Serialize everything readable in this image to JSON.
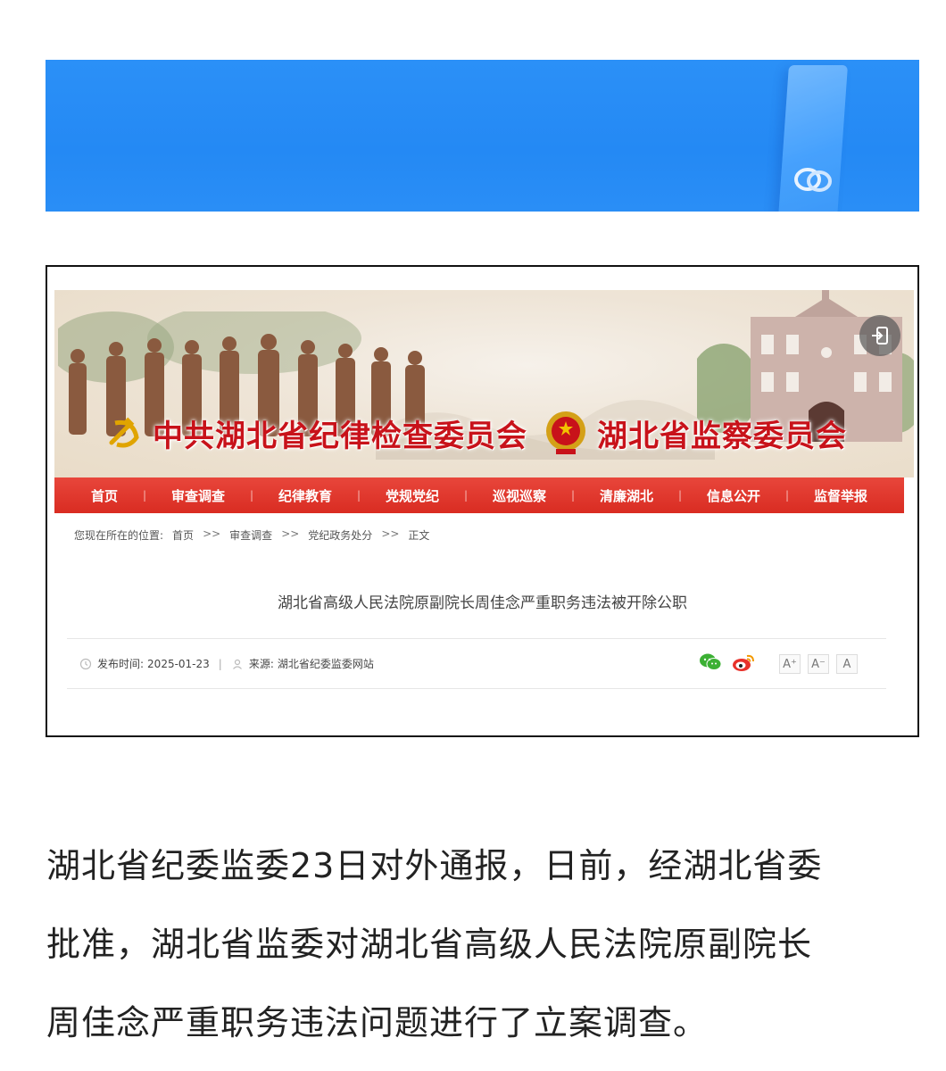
{
  "site": {
    "title_left": "中共湖北省纪律检查委员会",
    "title_right": "湖北省监察委员会"
  },
  "nav": [
    {
      "label": "首页"
    },
    {
      "label": "审查调查"
    },
    {
      "label": "纪律教育"
    },
    {
      "label": "党规党纪"
    },
    {
      "label": "巡视巡察"
    },
    {
      "label": "清廉湖北"
    },
    {
      "label": "信息公开"
    },
    {
      "label": "监督举报"
    }
  ],
  "breadcrumb": {
    "prefix": "您现在所在的位置:",
    "items": [
      "首页",
      "审查调查",
      "党纪政务处分",
      "正文"
    ],
    "separator": ">>"
  },
  "article": {
    "title": "湖北省高级人民法院原副院长周佳念严重职务违法被开除公职",
    "publish_label": "发布时间:",
    "publish_date": "2025-01-23",
    "source_label": "来源:",
    "source": "湖北省纪委监委网站",
    "meta_divider": "|"
  },
  "font_sizes": [
    "A⁺",
    "A⁻",
    "A"
  ],
  "body": {
    "lines": [
      "湖北省纪委监委23日对外通报，日前，经湖北省委",
      "批准，湖北省监委对湖北省高级人民法院原副院长",
      "周佳念严重职务违法问题进行了立案调查。"
    ]
  },
  "colors": {
    "banner_blue": "#2489f4",
    "nav_red": "#d92c22",
    "title_red": "#c8121a"
  },
  "icons": {
    "banner": "cloud-logo-icon",
    "login": "login-icon",
    "wechat": "wechat-icon",
    "weibo": "weibo-icon",
    "clock": "clock-icon",
    "user": "user-icon"
  }
}
